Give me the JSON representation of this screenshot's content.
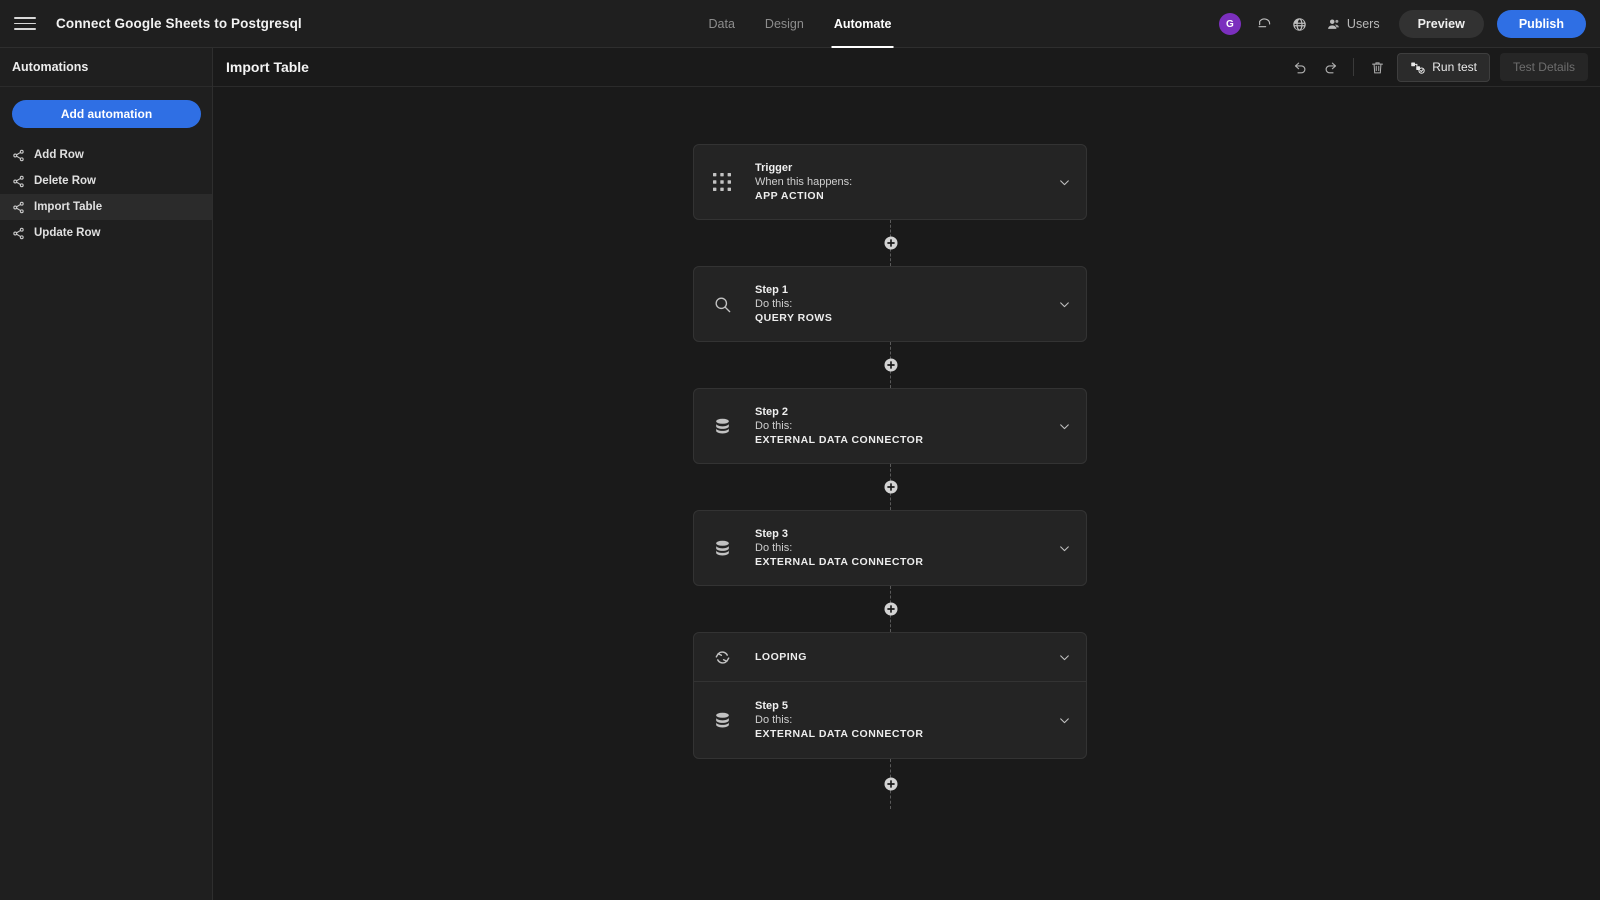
{
  "topbar": {
    "menu_icon": "hamburger-icon",
    "app_title": "Connect Google Sheets to Postgresql",
    "tabs": [
      {
        "label": "Data",
        "active": false
      },
      {
        "label": "Design",
        "active": false
      },
      {
        "label": "Automate",
        "active": true
      }
    ],
    "avatar_initial": "G",
    "undo_icon": "undo-icon",
    "globe_icon": "globe-icon",
    "users_icon": "users-icon",
    "users_label": "Users",
    "preview_label": "Preview",
    "publish_label": "Publish",
    "publish_color": "#2f6fe4",
    "avatar_color": "#7b2fbe"
  },
  "sidebar": {
    "header": "Automations",
    "add_button": "Add automation",
    "items": [
      {
        "label": "Add Row",
        "icon": "share-icon",
        "selected": false
      },
      {
        "label": "Delete Row",
        "icon": "share-icon",
        "selected": false
      },
      {
        "label": "Import Table",
        "icon": "share-icon",
        "selected": true
      },
      {
        "label": "Update Row",
        "icon": "share-icon",
        "selected": false
      }
    ]
  },
  "main_header": {
    "title": "Import Table",
    "undo_icon": "undo-icon",
    "redo_icon": "redo-icon",
    "delete_icon": "trash-icon",
    "run_test_label": "Run test",
    "run_test_icon": "run-test-icon",
    "test_details_label": "Test Details",
    "test_details_disabled": true
  },
  "flow": {
    "nodes": [
      {
        "kind": "card",
        "icon": "grid-dots-icon",
        "step": "Trigger",
        "sub": "When this happens:",
        "type": "APP ACTION"
      },
      {
        "kind": "card",
        "icon": "search-icon",
        "step": "Step 1",
        "sub": "Do this:",
        "type": "QUERY ROWS"
      },
      {
        "kind": "card",
        "icon": "database-icon",
        "step": "Step 2",
        "sub": "Do this:",
        "type": "EXTERNAL DATA CONNECTOR"
      },
      {
        "kind": "card",
        "icon": "database-icon",
        "step": "Step 3",
        "sub": "Do this:",
        "type": "EXTERNAL DATA CONNECTOR"
      },
      {
        "kind": "group",
        "looping": {
          "icon": "loop-icon",
          "label": "LOOPING"
        },
        "card": {
          "icon": "database-icon",
          "step": "Step 5",
          "sub": "Do this:",
          "type": "EXTERNAL DATA CONNECTOR"
        }
      }
    ],
    "add_step_icon": "plus-circle-icon"
  }
}
